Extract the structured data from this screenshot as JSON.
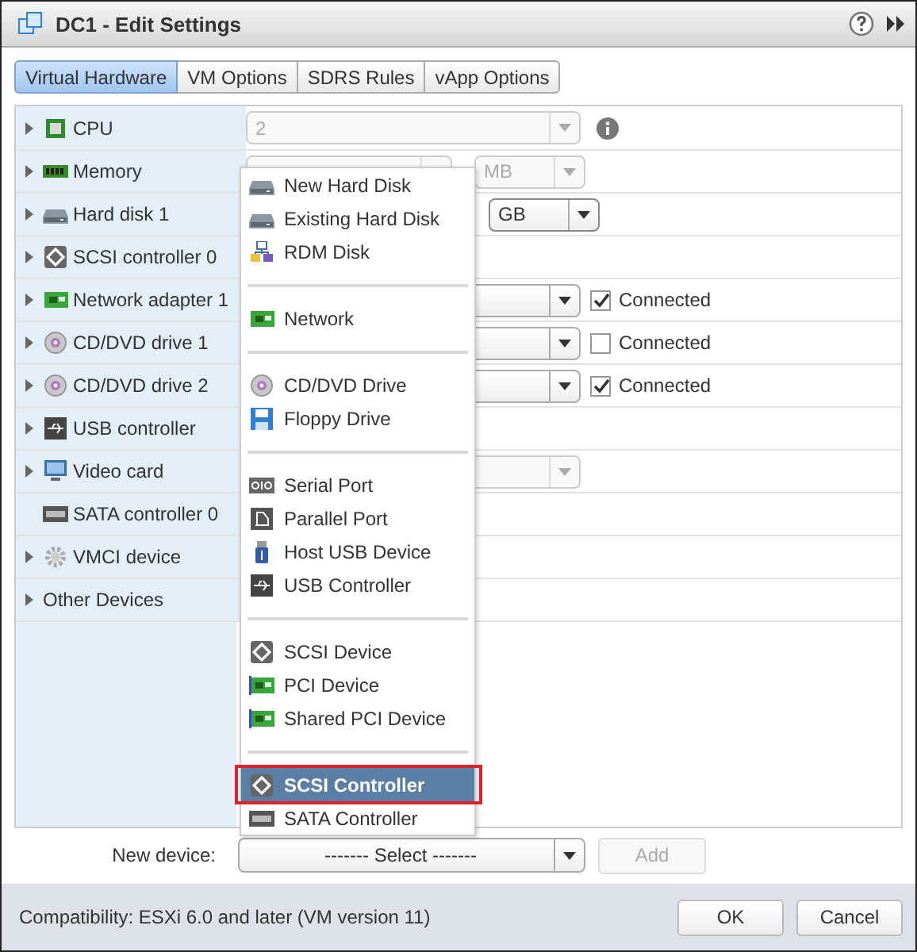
{
  "window": {
    "title": "DC1 - Edit Settings"
  },
  "tabs": [
    {
      "label": "Virtual Hardware",
      "selected": true
    },
    {
      "label": "VM Options",
      "selected": false
    },
    {
      "label": "SDRS Rules",
      "selected": false
    },
    {
      "label": "vApp Options",
      "selected": false
    }
  ],
  "devices": [
    {
      "label": "CPU",
      "kind": "cpu",
      "expandable": true,
      "field": {
        "kind": "select",
        "value": "2",
        "disabled": true
      },
      "info": true
    },
    {
      "label": "Memory",
      "kind": "memory",
      "expandable": true,
      "field": {
        "kind": "input",
        "disabled": true
      },
      "unit": {
        "value": "MB",
        "disabled": true
      }
    },
    {
      "label": "Hard disk 1",
      "kind": "disk",
      "expandable": true,
      "unit": {
        "value": "GB",
        "disabled": false
      }
    },
    {
      "label": "SCSI controller 0",
      "kind": "scsi",
      "expandable": true
    },
    {
      "label": "Network adapter 1",
      "kind": "network",
      "expandable": true,
      "field": {
        "kind": "select",
        "disabled": false
      },
      "connected": {
        "label": "Connected",
        "checked": true
      }
    },
    {
      "label": "CD/DVD drive 1",
      "kind": "cd",
      "expandable": true,
      "field": {
        "kind": "select",
        "disabled": false
      },
      "connected": {
        "label": "Connected",
        "checked": false
      }
    },
    {
      "label": "CD/DVD drive 2",
      "kind": "cd",
      "expandable": true,
      "field": {
        "kind": "select",
        "disabled": false
      },
      "connected": {
        "label": "Connected",
        "checked": true
      }
    },
    {
      "label": "USB controller",
      "kind": "usb",
      "expandable": true
    },
    {
      "label": "Video card",
      "kind": "video",
      "expandable": true,
      "field": {
        "kind": "select",
        "disabled": true
      }
    },
    {
      "label": "SATA controller 0",
      "kind": "sata",
      "expandable": false
    },
    {
      "label": "VMCI device",
      "kind": "gear",
      "expandable": true
    },
    {
      "label": "Other Devices",
      "expandable": true
    }
  ],
  "menu": {
    "groups": [
      [
        {
          "label": "New Hard Disk",
          "kind": "disk",
          "selected": false,
          "outlined": false
        },
        {
          "label": "Existing Hard Disk",
          "kind": "disk",
          "selected": false,
          "outlined": false
        },
        {
          "label": "RDM Disk",
          "kind": "rdm",
          "selected": false,
          "outlined": false
        }
      ],
      [
        {
          "label": "Network",
          "kind": "network",
          "selected": false,
          "outlined": false
        }
      ],
      [
        {
          "label": "CD/DVD Drive",
          "kind": "cd",
          "selected": false,
          "outlined": false
        },
        {
          "label": "Floppy Drive",
          "kind": "floppy",
          "selected": false,
          "outlined": false
        }
      ],
      [
        {
          "label": "Serial Port",
          "kind": "serial",
          "selected": false,
          "outlined": false
        },
        {
          "label": "Parallel Port",
          "kind": "parallel",
          "selected": false,
          "outlined": false
        },
        {
          "label": "Host USB Device",
          "kind": "hostusb",
          "selected": false,
          "outlined": false
        },
        {
          "label": "USB Controller",
          "kind": "usb",
          "selected": false,
          "outlined": false
        }
      ],
      [
        {
          "label": "SCSI Device",
          "kind": "scsi",
          "selected": false,
          "outlined": false
        },
        {
          "label": "PCI Device",
          "kind": "pci",
          "selected": false,
          "outlined": false
        },
        {
          "label": "Shared PCI Device",
          "kind": "pci",
          "selected": false,
          "outlined": false
        }
      ],
      [
        {
          "label": "SCSI Controller",
          "kind": "scsi",
          "selected": true,
          "outlined": true
        },
        {
          "label": "SATA Controller",
          "kind": "sata",
          "selected": false,
          "outlined": false
        }
      ]
    ]
  },
  "new_device": {
    "label": "New device:",
    "select": "------- Select -------",
    "add": {
      "label": "Add",
      "disabled": true
    }
  },
  "footer": {
    "compatibility": "Compatibility: ESXi 6.0 and later (VM version 11)",
    "buttons": [
      "OK",
      "Cancel"
    ]
  }
}
